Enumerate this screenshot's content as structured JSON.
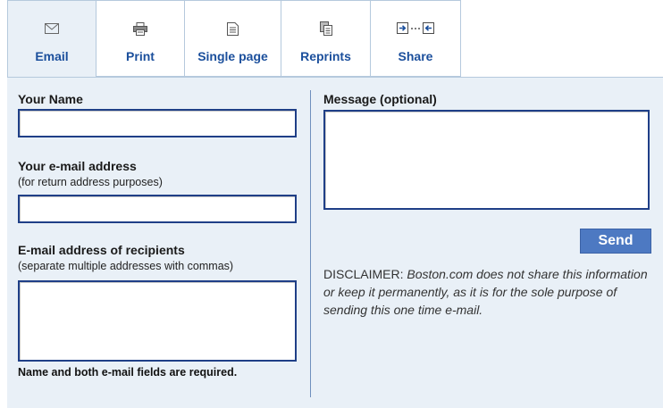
{
  "tabs": [
    {
      "label": "Email",
      "icon": "envelope-icon",
      "active": true
    },
    {
      "label": "Print",
      "icon": "printer-icon",
      "active": false
    },
    {
      "label": "Single page",
      "icon": "page-icon",
      "active": false
    },
    {
      "label": "Reprints",
      "icon": "copies-icon",
      "active": false
    },
    {
      "label": "Share",
      "icon": "share-icon",
      "active": false
    }
  ],
  "form": {
    "name_label": "Your Name",
    "name_value": "",
    "email_label": "Your e-mail address",
    "email_hint": "(for return address purposes)",
    "email_value": "",
    "recipients_label": "E-mail address of recipients",
    "recipients_hint": "(separate multiple addresses with commas)",
    "recipients_value": "",
    "required_note": "Name and both e-mail fields are required.",
    "message_label": "Message (optional)",
    "message_value": "",
    "send_label": "Send",
    "disclaimer_lead": "DISCLAIMER:",
    "disclaimer_text": "Boston.com does not share this information or keep it permanently, as it is for the sole purpose of sending this one time e-mail."
  },
  "colors": {
    "accent": "#4d79c2",
    "tab_text": "#1b4f9c",
    "panel_bg": "#e9f0f7",
    "field_border": "#1f3f87"
  }
}
